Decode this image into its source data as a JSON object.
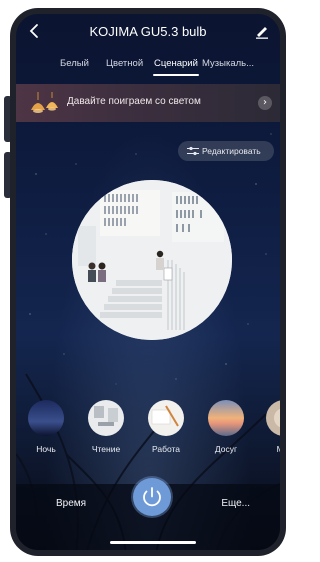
{
  "header": {
    "back_icon": "chevron-left-icon",
    "title": "KOJIMA GU5.3 bulb",
    "edit_icon": "pencil-icon"
  },
  "tabs": [
    {
      "label": "Белый"
    },
    {
      "label": "Цветной"
    },
    {
      "label": "Сценарий",
      "active": true
    },
    {
      "label": "Музыкаль..."
    }
  ],
  "banner": {
    "icon": "lamps-icon",
    "text": "Давайте поиграем со светом",
    "arrow_icon": "chevron-right-icon"
  },
  "edit_scene": {
    "icon": "sliders-icon",
    "label": "Редактировать"
  },
  "current_scene": {
    "image": "library-reading-image"
  },
  "scenes": [
    {
      "label": "Ночь"
    },
    {
      "label": "Чтение"
    },
    {
      "label": "Работа"
    },
    {
      "label": "Досуг"
    },
    {
      "label": "Мяг"
    }
  ],
  "bottom": {
    "time_label": "Время",
    "power_icon": "power-icon",
    "more_label": "Еще..."
  },
  "colors": {
    "accent": "#6f9ad8",
    "banner_start": "#4e3545",
    "background_top": "#0b1430"
  }
}
